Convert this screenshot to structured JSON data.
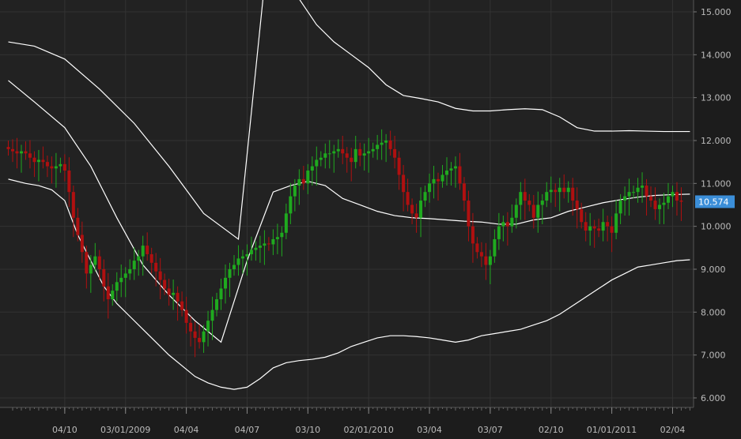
{
  "colors": {
    "background": "#222222",
    "grid": "#333333",
    "up_candle": "#1faa1f",
    "down_candle": "#b01010",
    "band_line": "#ffffff",
    "axis_text": "#bbbbbb",
    "price_marker_bg": "#3b8ed8",
    "price_marker_text": "#ffffff"
  },
  "chart_data": {
    "type": "candlestick",
    "title": "",
    "xlabel": "",
    "ylabel": "",
    "ylim": [
      5.7,
      15.3
    ],
    "y_ticks": [
      6,
      7,
      8,
      9,
      10,
      11,
      12,
      13,
      14,
      15
    ],
    "y_tick_labels": [
      "6.000",
      "7.000",
      "8.000",
      "9.000",
      "10.000",
      "11.000",
      "12.000",
      "13.000",
      "14.000",
      "15.000"
    ],
    "x_ticks": [
      {
        "label": "04/10",
        "index": 12
      },
      {
        "label": "03/01/2009",
        "index": 26
      },
      {
        "label": "04/04",
        "index": 40
      },
      {
        "label": "04/07",
        "index": 54
      },
      {
        "label": "03/10",
        "index": 68
      },
      {
        "label": "02/01/2010",
        "index": 82
      },
      {
        "label": "03/04",
        "index": 96
      },
      {
        "label": "03/07",
        "index": 110
      },
      {
        "label": "02/10",
        "index": 124
      },
      {
        "label": "01/01/2011",
        "index": 138
      },
      {
        "label": "02/04",
        "index": 152
      }
    ],
    "grid": true,
    "last_price": "10.574",
    "last_price_value": 10.574,
    "series": [
      {
        "kind": "ohlc",
        "x_start": -1,
        "close": [
          11.8,
          11.75,
          11.7,
          11.75,
          11.7,
          11.6,
          11.5,
          11.55,
          11.5,
          11.4,
          11.35,
          11.4,
          11.45,
          11.3,
          10.8,
          10.2,
          9.8,
          9.4,
          8.9,
          9.1,
          9.3,
          9.0,
          8.6,
          8.3,
          8.5,
          8.7,
          8.8,
          8.9,
          9.0,
          9.2,
          9.3,
          9.55,
          9.35,
          9.15,
          8.95,
          8.75,
          8.55,
          8.4,
          8.45,
          8.25,
          8.05,
          7.75,
          7.55,
          7.4,
          7.3,
          7.55,
          7.8,
          8.05,
          8.3,
          8.55,
          8.8,
          9.0,
          9.1,
          9.25,
          9.3,
          9.35,
          9.45,
          9.5,
          9.55,
          9.6,
          9.58,
          9.7,
          9.75,
          9.85,
          10.3,
          10.7,
          10.95,
          11.1,
          11.0,
          11.3,
          11.4,
          11.55,
          11.6,
          11.7,
          11.7,
          11.75,
          11.8,
          11.7,
          11.6,
          11.5,
          11.8,
          11.65,
          11.7,
          11.75,
          11.8,
          11.9,
          11.95,
          12.0,
          11.8,
          11.6,
          11.2,
          10.8,
          10.5,
          10.3,
          10.2,
          10.6,
          10.8,
          11.0,
          11.1,
          11.05,
          11.2,
          11.3,
          11.35,
          11.4,
          11.0,
          10.6,
          10.0,
          9.6,
          9.4,
          9.3,
          9.1,
          9.3,
          9.7,
          10.0,
          10.1,
          10.0,
          10.2,
          10.5,
          10.8,
          10.6,
          10.5,
          10.2,
          10.5,
          10.6,
          10.8,
          10.85,
          10.8,
          10.9,
          10.8,
          10.9,
          10.6,
          10.4,
          10.1,
          9.9,
          10.0,
          9.95,
          9.9,
          10.1,
          10.0,
          9.85,
          10.3,
          10.6,
          10.7,
          10.8,
          10.8,
          10.9,
          10.95,
          10.7,
          10.6,
          10.4,
          10.5,
          10.55,
          10.7,
          10.8,
          10.6,
          10.574
        ],
        "note": "close values per bar; opens are previous close"
      },
      {
        "kind": "line",
        "role": "upper-band",
        "x": [
          -1,
          5,
          12,
          20,
          28,
          36,
          44,
          52,
          58,
          62,
          66,
          70,
          74,
          78,
          82,
          86,
          90,
          94,
          98,
          102,
          106,
          110,
          114,
          118,
          122,
          126,
          130,
          134,
          138,
          142,
          146,
          150,
          156
        ],
        "y": [
          14.3,
          14.2,
          13.9,
          13.2,
          12.4,
          11.4,
          10.3,
          9.7,
          16.0,
          15.9,
          15.3,
          14.7,
          14.3,
          14.0,
          13.7,
          13.3,
          13.05,
          12.98,
          12.9,
          12.75,
          12.69,
          12.69,
          12.72,
          12.74,
          12.72,
          12.55,
          12.3,
          12.22,
          12.22,
          12.23,
          12.22,
          12.21,
          12.21
        ]
      },
      {
        "kind": "line",
        "role": "middle-band",
        "x": [
          -1,
          5,
          12,
          18,
          24,
          30,
          36,
          42,
          48,
          54,
          60,
          64,
          68,
          72,
          76,
          80,
          84,
          88,
          92,
          96,
          100,
          104,
          108,
          112,
          116,
          120,
          124,
          128,
          132,
          136,
          140,
          144,
          148,
          152,
          156
        ],
        "y": [
          13.4,
          12.9,
          12.3,
          11.4,
          10.2,
          9.1,
          8.4,
          7.8,
          7.3,
          9.2,
          10.8,
          10.95,
          11.05,
          10.95,
          10.65,
          10.5,
          10.35,
          10.25,
          10.2,
          10.18,
          10.15,
          10.12,
          10.1,
          10.05,
          10.05,
          10.15,
          10.2,
          10.35,
          10.45,
          10.55,
          10.62,
          10.68,
          10.72,
          10.74,
          10.75
        ]
      },
      {
        "kind": "line",
        "role": "lower-band",
        "x": [
          -1,
          3,
          6,
          9,
          12,
          15,
          18,
          21,
          24,
          27,
          30,
          33,
          36,
          39,
          42,
          45,
          48,
          51,
          54,
          57,
          60,
          63,
          66,
          69,
          72,
          75,
          78,
          81,
          84,
          87,
          90,
          93,
          96,
          99,
          102,
          105,
          108,
          111,
          114,
          117,
          120,
          123,
          126,
          129,
          132,
          135,
          138,
          141,
          144,
          147,
          150,
          153,
          156
        ],
        "y": [
          11.1,
          11.0,
          10.95,
          10.85,
          10.6,
          9.8,
          9.2,
          8.6,
          8.2,
          7.9,
          7.6,
          7.3,
          7.0,
          6.75,
          6.5,
          6.35,
          6.25,
          6.2,
          6.25,
          6.45,
          6.7,
          6.82,
          6.87,
          6.9,
          6.95,
          7.05,
          7.2,
          7.3,
          7.4,
          7.45,
          7.45,
          7.43,
          7.4,
          7.35,
          7.3,
          7.35,
          7.45,
          7.5,
          7.55,
          7.6,
          7.7,
          7.8,
          7.95,
          8.15,
          8.35,
          8.55,
          8.75,
          8.9,
          9.05,
          9.1,
          9.15,
          9.2,
          9.22
        ]
      }
    ]
  }
}
